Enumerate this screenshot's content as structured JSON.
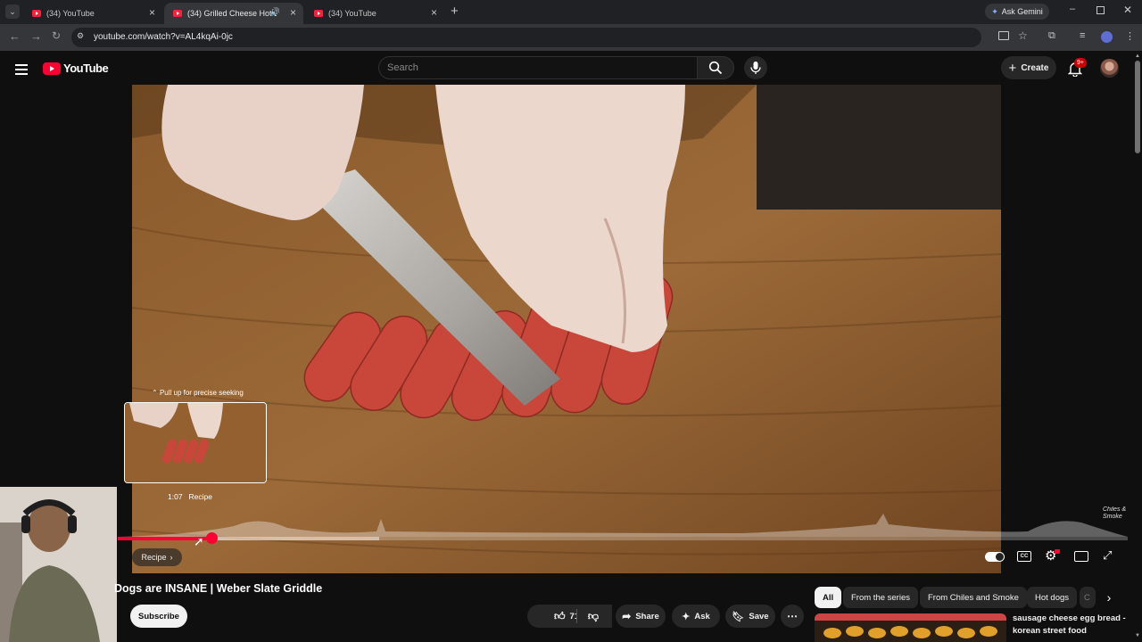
{
  "browser": {
    "tabs": [
      {
        "title": "(34) YouTube"
      },
      {
        "title": "(34) Grilled Cheese Hot Do"
      },
      {
        "title": "(34) YouTube"
      }
    ],
    "gemini_label": "Ask Gemini",
    "url": "youtube.com/watch?v=AL4kqAi-0jc"
  },
  "youtube": {
    "logo_text": "YouTube",
    "search_placeholder": "Search",
    "create_label": "Create",
    "notification_badge": "9+"
  },
  "player": {
    "seek_hint": "Pull up for precise seeking",
    "preview_time": "1:07",
    "preview_chapter": "Recipe",
    "chapter_button": "Recipe",
    "progress_played": 0.093,
    "progress_buffered": 0.259,
    "watermark": "Chiles & Smoke"
  },
  "video_info": {
    "title": "Dogs are INSANE | Weber Slate Griddle",
    "subscribe_label": "Subscribe",
    "like_count": "71K",
    "share_label": "Share",
    "ask_label": "Ask",
    "save_label": "Save"
  },
  "filters": {
    "chips": [
      "All",
      "From the series",
      "From Chiles and Smoke",
      "Hot dogs",
      "C"
    ]
  },
  "recommendation": {
    "title_line1": "sausage cheese egg bread -",
    "title_line2": "korean street food"
  },
  "colors": {
    "yt_red": "#ff0033",
    "background": "#0f0f0f",
    "chip_bg": "#272727"
  }
}
